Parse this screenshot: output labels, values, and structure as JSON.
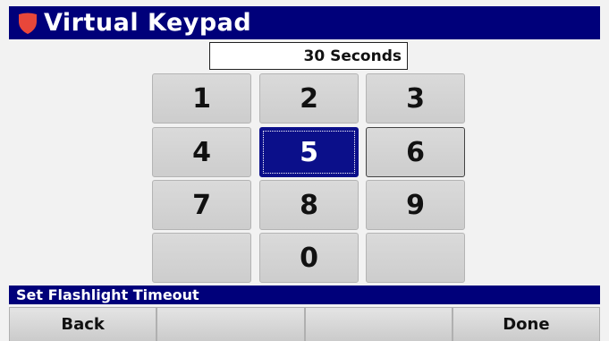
{
  "header": {
    "title": "Virtual Keypad",
    "logo_icon": "shield-logo-icon",
    "logo_color": "#e8473a",
    "bar_color": "#00007a"
  },
  "display": {
    "value": "30 Seconds"
  },
  "keypad": {
    "keys": [
      {
        "label": "1"
      },
      {
        "label": "2"
      },
      {
        "label": "3"
      },
      {
        "label": "4"
      },
      {
        "label": "5",
        "selected": true
      },
      {
        "label": "6"
      },
      {
        "label": "7"
      },
      {
        "label": "8"
      },
      {
        "label": "9"
      },
      {
        "label": ""
      },
      {
        "label": "0"
      },
      {
        "label": ""
      }
    ],
    "selected_color": "#0b0f8a"
  },
  "prompt": {
    "text": "Set Flashlight Timeout"
  },
  "softkeys": {
    "items": [
      {
        "label": "Back"
      },
      {
        "label": ""
      },
      {
        "label": ""
      },
      {
        "label": "Done"
      }
    ]
  }
}
